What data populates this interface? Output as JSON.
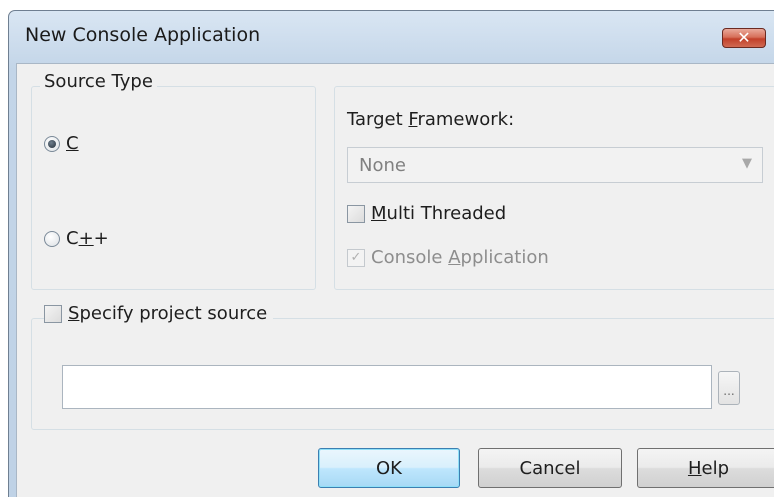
{
  "window": {
    "title": "New Console Application"
  },
  "source_type": {
    "legend": "Source Type",
    "options": [
      {
        "prefix": "",
        "mnemonic": "C",
        "suffix": "",
        "selected": true
      },
      {
        "prefix": "C",
        "mnemonic": "+",
        "suffix": "+",
        "selected": false
      }
    ]
  },
  "framework": {
    "label_prefix": "Target ",
    "label_mnemonic": "F",
    "label_suffix": "ramework:",
    "value": "None",
    "arrow_icon": "▼"
  },
  "multi_threaded": {
    "mnemonic": "M",
    "rest": "ulti Threaded",
    "checked": false
  },
  "console_app": {
    "prefix": "Console ",
    "mnemonic": "A",
    "suffix": "pplication",
    "checked": true,
    "check_glyph": "✓"
  },
  "project_source": {
    "mnemonic": "S",
    "rest": "pecify project source",
    "checked": false,
    "value": "",
    "browse_label": "..."
  },
  "buttons": {
    "ok": "OK",
    "cancel": "Cancel",
    "help_mnemonic": "H",
    "help_rest": "elp"
  },
  "close_glyph": "✕"
}
